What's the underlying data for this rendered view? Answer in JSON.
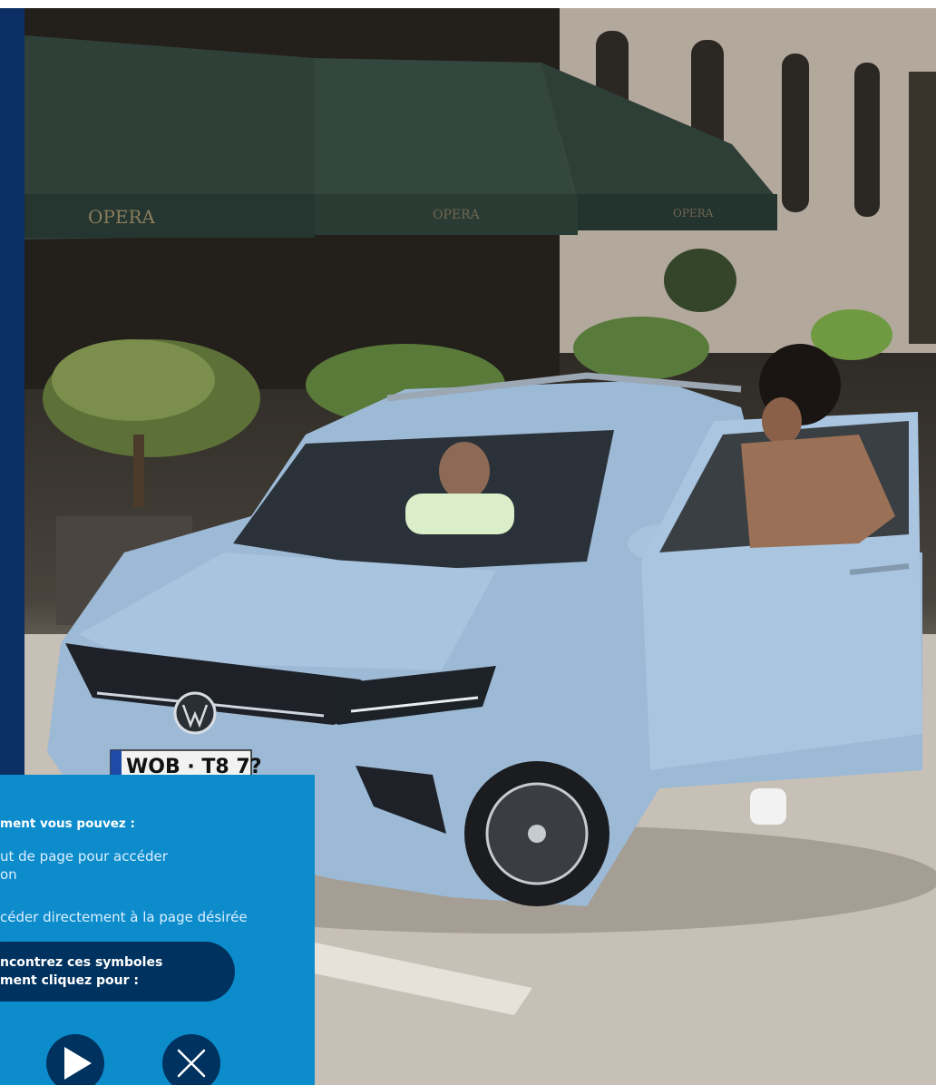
{
  "hero": {
    "awning_text": "OPERA",
    "plate_text": "WOB · T8 7?"
  },
  "info_panel": {
    "heading": "ment vous pouvez :",
    "lines": [
      "ut de page pour accéder",
      "on",
      "céder directement à la page désirée"
    ],
    "pill_line1": "ncontrez ces symboles",
    "pill_line2": "ment cliquez pour :",
    "play_icon": "play-icon",
    "close_icon": "close-icon"
  },
  "colors": {
    "sidebar": "#0b2f64",
    "panel": "#0d8ccc",
    "pill": "#00325f"
  }
}
